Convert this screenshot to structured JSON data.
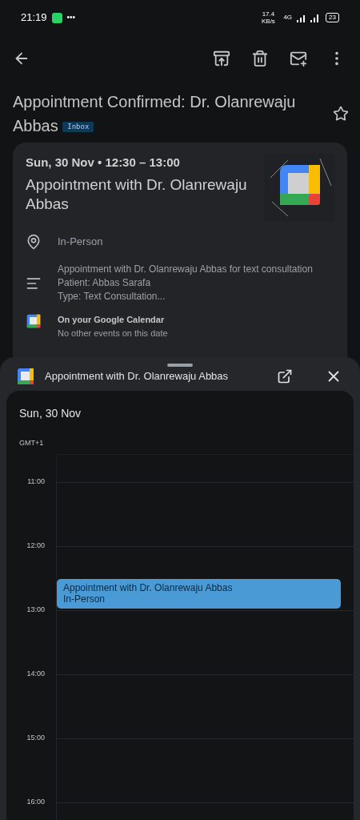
{
  "status_bar": {
    "time": "21:19",
    "more": "•••",
    "speed": "17.4 KB/s",
    "network": "4G",
    "battery": "23"
  },
  "email": {
    "subject": "Appointment Confirmed: Dr. Olanrewaju Abbas",
    "label": "Inbox",
    "starred": false
  },
  "event_card": {
    "when": "Sun, 30 Nov • 12:30 – 13:00",
    "title": "Appointment with Dr. Olanrewaju Abbas",
    "location": "In-Person",
    "description": [
      "Appointment with Dr. Olanrewaju Abbas for text consultation",
      "Patient: Abbas Sarafa",
      "Type: Text Consultation..."
    ],
    "calendar_heading": "On your Google Calendar",
    "calendar_note": "No other events on this date"
  },
  "sheet": {
    "title": "Appointment with Dr. Olanrewaju Abbas",
    "date": "Sun, 30 Nov",
    "timezone": "GMT+1",
    "hours": [
      {
        "label": "11:00"
      },
      {
        "label": "12:00",
        "events": [
          {
            "title": "Appointment with Dr. Olanrewaju Abbas",
            "location": "In-Person",
            "color": "#4a9ad6"
          }
        ]
      },
      {
        "label": "13:00"
      },
      {
        "label": "14:00"
      },
      {
        "label": "15:00"
      },
      {
        "label": "16:00"
      }
    ]
  }
}
